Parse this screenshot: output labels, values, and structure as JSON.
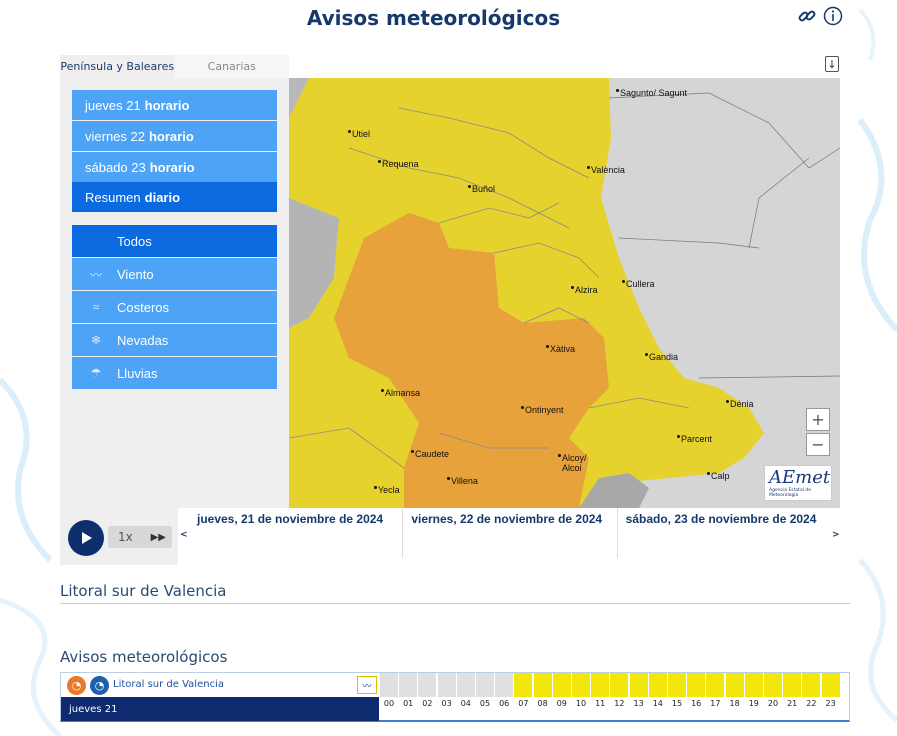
{
  "title": "Avisos meteorológicos",
  "icons": {
    "link": "link-icon",
    "info": "info-icon",
    "download": "download-icon"
  },
  "tabs": [
    "Península y Baleares",
    "Canarias"
  ],
  "days_menu": [
    {
      "day": "jueves 21",
      "mode": "horario"
    },
    {
      "day": "viernes 22",
      "mode": "horario"
    },
    {
      "day": "sábado 23",
      "mode": "horario"
    },
    {
      "day": "Resumen",
      "mode": "diario"
    }
  ],
  "categories": [
    {
      "label": "Todos",
      "icon": ""
    },
    {
      "label": "Viento",
      "icon": "wind-icon"
    },
    {
      "label": "Costeros",
      "icon": "waves-icon"
    },
    {
      "label": "Nevadas",
      "icon": "snowflake-icon"
    },
    {
      "label": "Lluvias",
      "icon": "rain-icon"
    }
  ],
  "map": {
    "towns": [
      "Sagunto/ Sagunt",
      "Utiel",
      "Requena",
      "Buñol",
      "València",
      "Alzira",
      "Cullera",
      "Xàtiva",
      "Gandia",
      "Almansa",
      "Ontinyent",
      "Dénia",
      "Caudete",
      "Alcoy/ Alcoi",
      "Villena",
      "Parcent",
      "Yecla",
      "Calp"
    ],
    "colors": {
      "yellow": "#e8d42a",
      "orange": "#e8a03a",
      "land_grey": "#bfbfbf",
      "sea": "#d5d5d5"
    },
    "zoom": {
      "in": "+",
      "out": "−"
    },
    "logo": {
      "name": "AEmet",
      "sub": "Agencia Estatal de Meteorología"
    }
  },
  "player": {
    "speed": "1x",
    "fast_forward": "▶▶",
    "prev": "<",
    "next": ">"
  },
  "timeline_days": [
    "jueves, 21 de noviembre de 2024",
    "viernes, 22 de noviembre de 2024",
    "sábado, 23 de noviembre de 2024"
  ],
  "zone_title": "Litoral sur de Valencia",
  "warnings_title": "Avisos meteorológicos",
  "warnings_table": {
    "zone": "Litoral sur de Valencia",
    "day": "jueves 21",
    "hours": [
      "00",
      "01",
      "02",
      "03",
      "04",
      "05",
      "06",
      "07",
      "08",
      "09",
      "10",
      "11",
      "12",
      "13",
      "14",
      "15",
      "16",
      "17",
      "18",
      "19",
      "20",
      "21",
      "22",
      "23"
    ],
    "levels": [
      "none",
      "none",
      "none",
      "none",
      "none",
      "none",
      "none",
      "yellow",
      "yellow",
      "yellow",
      "yellow",
      "yellow",
      "yellow",
      "yellow",
      "yellow",
      "yellow",
      "yellow",
      "yellow",
      "yellow",
      "yellow",
      "yellow",
      "yellow",
      "yellow",
      "yellow"
    ],
    "level_colors": {
      "none": "#e0e0e0",
      "yellow": "#f2e60a"
    }
  }
}
